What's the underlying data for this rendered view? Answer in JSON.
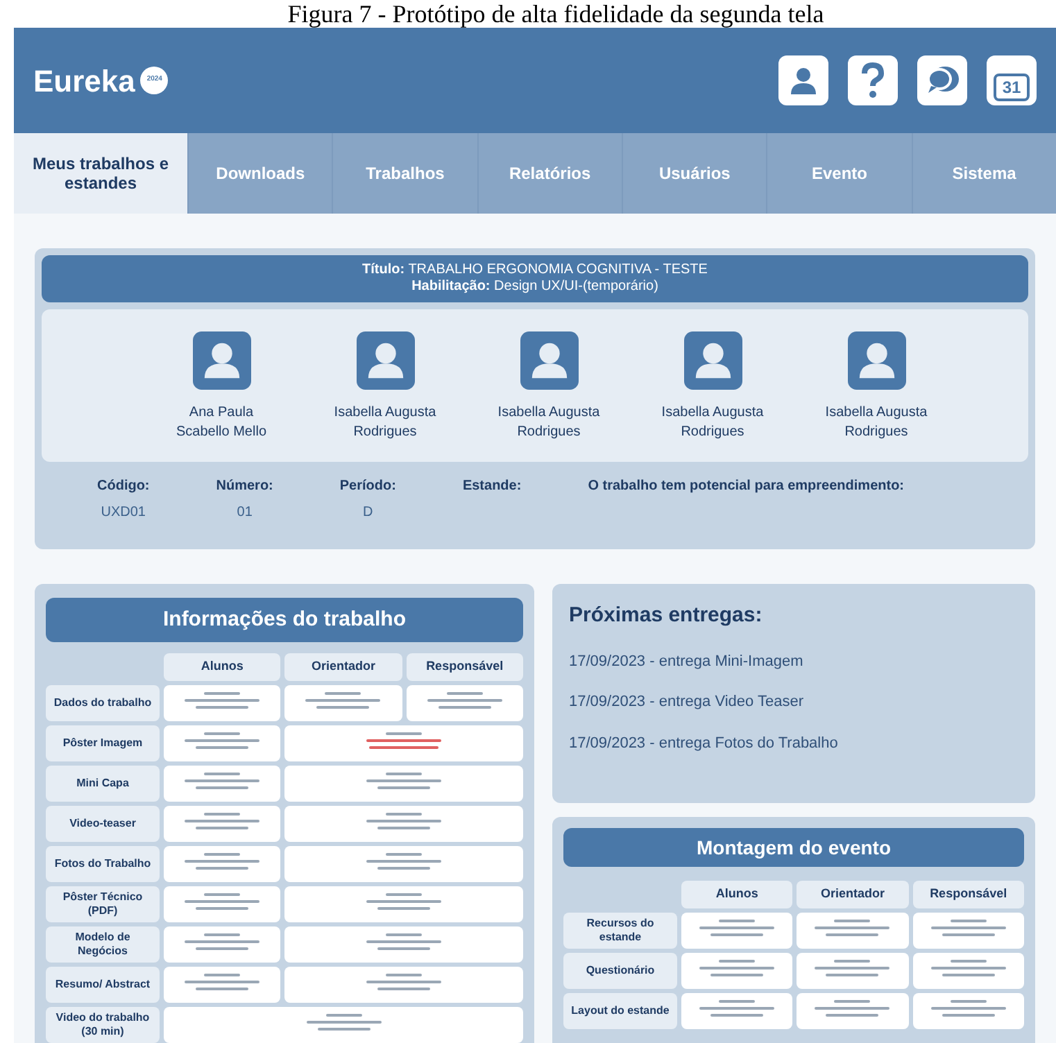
{
  "caption": "Figura 7 - Protótipo de alta fidelidade da segunda tela",
  "header": {
    "logo": "Eureka",
    "logo_badge": "2024",
    "calendar_day": "31"
  },
  "tabs": [
    {
      "label": "Meus trabalhos e estandes",
      "selected": true
    },
    {
      "label": "Downloads",
      "selected": false
    },
    {
      "label": "Trabalhos",
      "selected": false
    },
    {
      "label": "Relatórios",
      "selected": false
    },
    {
      "label": "Usuários",
      "selected": false
    },
    {
      "label": "Evento",
      "selected": false
    },
    {
      "label": "Sistema",
      "selected": false
    }
  ],
  "work": {
    "title_label": "Título:",
    "title": "TRABALHO ERGONOMIA COGNITIVA - TESTE",
    "qualification_label": "Habilitação:",
    "qualification": "Design UX/UI-(temporário)",
    "members": [
      "Ana Paula Scabello Mello",
      "Isabella Augusta Rodrigues",
      "Isabella Augusta Rodrigues",
      "Isabella Augusta Rodrigues",
      "Isabella Augusta Rodrigues"
    ],
    "fields": [
      {
        "label": "Código:",
        "value": "UXD01"
      },
      {
        "label": "Número:",
        "value": "01"
      },
      {
        "label": "Período:",
        "value": "D"
      },
      {
        "label": "Estande:"
      },
      {
        "label": "O trabalho tem potencial para empreendimento:"
      }
    ]
  },
  "info_table": {
    "title": "Informações do trabalho",
    "columns": [
      "Alunos",
      "Orientador",
      "Responsável"
    ],
    "rows": [
      {
        "label": "Dados do trabalho",
        "cells": [
          {
            "kind": "single",
            "rejected": false
          },
          {
            "kind": "single",
            "rejected": false
          },
          {
            "kind": "single",
            "rejected": false
          }
        ]
      },
      {
        "label": "Pôster Imagem",
        "cells": [
          {
            "kind": "single",
            "rejected": false
          },
          {
            "kind": "shared",
            "rejected": true
          }
        ]
      },
      {
        "label": "Mini Capa",
        "cells": [
          {
            "kind": "single",
            "rejected": false
          },
          {
            "kind": "shared",
            "rejected": false
          }
        ]
      },
      {
        "label": "Video-teaser",
        "cells": [
          {
            "kind": "single",
            "rejected": false
          },
          {
            "kind": "shared",
            "rejected": false
          }
        ]
      },
      {
        "label": "Fotos do Trabalho",
        "cells": [
          {
            "kind": "single",
            "rejected": false
          },
          {
            "kind": "shared",
            "rejected": false
          }
        ]
      },
      {
        "label": "Pôster Técnico (PDF)",
        "cells": [
          {
            "kind": "single",
            "rejected": false
          },
          {
            "kind": "shared",
            "rejected": false
          }
        ]
      },
      {
        "label": "Modelo de Negócios",
        "cells": [
          {
            "kind": "single",
            "rejected": false
          },
          {
            "kind": "shared",
            "rejected": false
          }
        ]
      },
      {
        "label": "Resumo/ Abstract",
        "cells": [
          {
            "kind": "single",
            "rejected": false
          },
          {
            "kind": "shared",
            "rejected": false
          }
        ]
      },
      {
        "label": "Video do trabalho (30 min)",
        "cells": [
          {
            "kind": "full",
            "rejected": false
          }
        ]
      }
    ]
  },
  "deliveries": {
    "title": "Próximas entregas:",
    "items": [
      "17/09/2023 - entrega Mini-Imagem",
      "17/09/2023 - entrega Video Teaser",
      "17/09/2023 - entrega Fotos do Trabalho"
    ]
  },
  "event_table": {
    "title": "Montagem do evento",
    "columns": [
      "Alunos",
      "Orientador",
      "Responsável"
    ],
    "rows": [
      {
        "label": "Recursos do estande",
        "cells": [
          {
            "kind": "single",
            "rejected": false
          },
          {
            "kind": "single",
            "rejected": false
          },
          {
            "kind": "single",
            "rejected": false
          }
        ]
      },
      {
        "label": "Questionário",
        "cells": [
          {
            "kind": "single",
            "rejected": false
          },
          {
            "kind": "single",
            "rejected": false
          },
          {
            "kind": "single",
            "rejected": false
          }
        ]
      },
      {
        "label": "Layout do estande",
        "cells": [
          {
            "kind": "single",
            "rejected": false
          },
          {
            "kind": "single",
            "rejected": false
          },
          {
            "kind": "single",
            "rejected": false
          }
        ]
      }
    ]
  }
}
